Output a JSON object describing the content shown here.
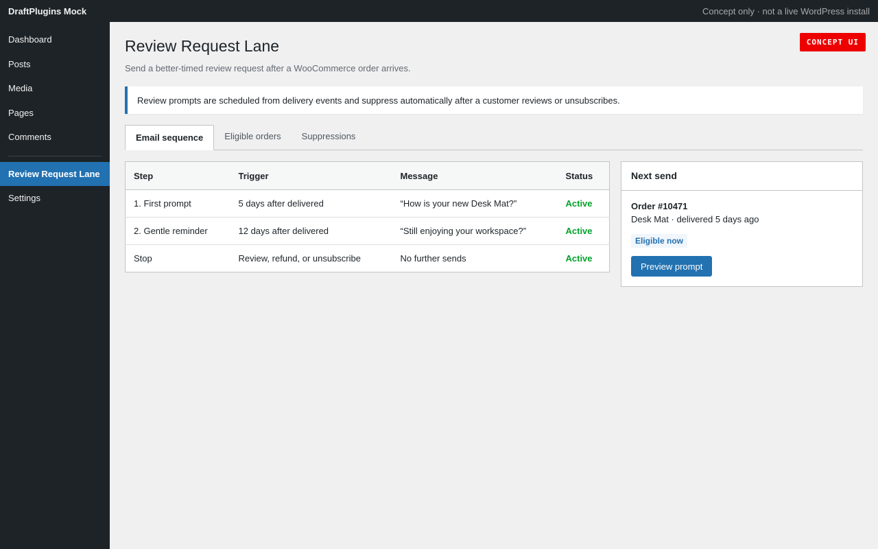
{
  "topbar": {
    "brand": "DraftPlugins Mock",
    "note": "Concept only · not a live WordPress install"
  },
  "sidebar": {
    "items": [
      {
        "label": "Dashboard"
      },
      {
        "label": "Posts"
      },
      {
        "label": "Media"
      },
      {
        "label": "Pages"
      },
      {
        "label": "Comments"
      }
    ],
    "plugin_items": [
      {
        "label": "Review Request Lane",
        "active": true
      },
      {
        "label": "Settings",
        "active": false
      }
    ]
  },
  "page": {
    "badge": "CONCEPT UI",
    "title": "Review Request Lane",
    "subtitle": "Send a better-timed review request after a WooCommerce order arrives.",
    "notice": "Review prompts are scheduled from delivery events and suppress automatically after a customer reviews or unsubscribes."
  },
  "tabs": [
    {
      "label": "Email sequence",
      "active": true
    },
    {
      "label": "Eligible orders",
      "active": false
    },
    {
      "label": "Suppressions",
      "active": false
    }
  ],
  "table": {
    "headers": [
      "Step",
      "Trigger",
      "Message",
      "Status"
    ],
    "rows": [
      [
        "1. First prompt",
        "5 days after delivered",
        "“How is your new Desk Mat?”",
        "Active"
      ],
      [
        "2. Gentle reminder",
        "12 days after delivered",
        "“Still enjoying your workspace?”",
        "Active"
      ],
      [
        "Stop",
        "Review, refund, or unsubscribe",
        "No further sends",
        "Active"
      ]
    ]
  },
  "next_send": {
    "heading": "Next send",
    "order": "Order #10471",
    "meta": "Desk Mat · delivered 5 days ago",
    "badge": "Eligible now",
    "button": "Preview prompt"
  },
  "colors": {
    "accent": "#2271b1",
    "sidebar_bg": "#1d2327",
    "status_active": "#00a32a",
    "concept_badge": "#ee0000"
  }
}
